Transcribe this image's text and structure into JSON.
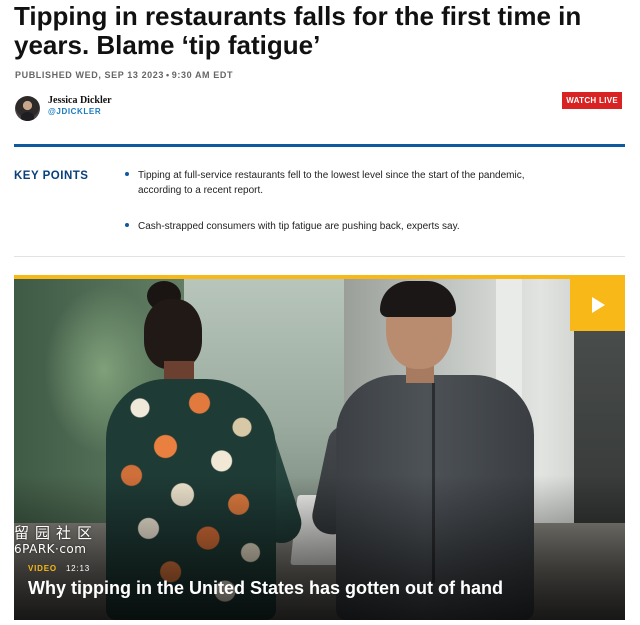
{
  "article": {
    "headline": "Tipping in restaurants falls for the first time in years. Blame ‘tip fatigue’",
    "published_label": "PUBLISHED",
    "published_date": "WED, SEP 13 2023",
    "published_separator": "•",
    "published_time": "9:30 AM EDT"
  },
  "author": {
    "name": "Jessica Dickler",
    "handle": "@JDICKLER"
  },
  "watch_live": {
    "label": "WATCH LIVE",
    "color": "#d92323"
  },
  "key_points": {
    "title": "KEY POINTS",
    "items": [
      "Tipping at full-service restaurants fell to the lowest level since the start of the pandemic, according to a recent report.",
      "Cash-strapped consumers with tip fatigue are pushing back, experts say."
    ],
    "accent_color": "#0f5a9f"
  },
  "video": {
    "tag": "VIDEO",
    "duration": "12:13",
    "title": "Why tipping in the United States has gotten out of hand",
    "play_icon": "play-icon",
    "accent_color": "#f7b818"
  },
  "watermark": {
    "chinese": "留园社区",
    "site": "6PARK·com"
  }
}
